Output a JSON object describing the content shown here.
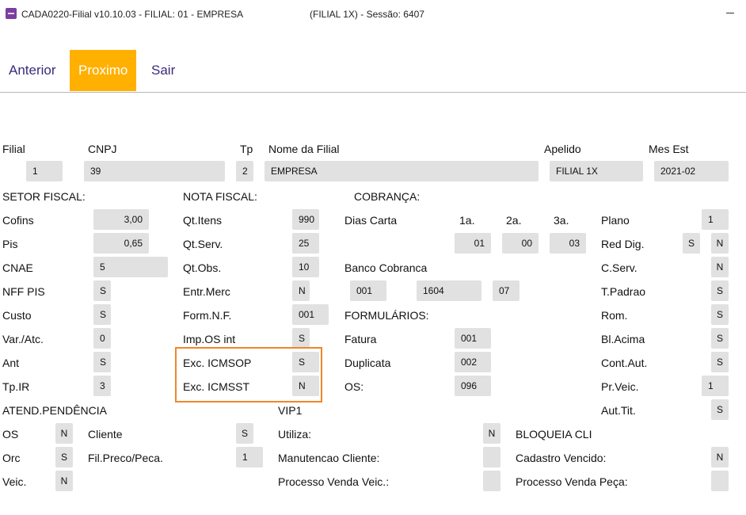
{
  "window": {
    "title": "CADA0220-Filial v10.10.03   - FILIAL: 01 - EMPRESA",
    "session": "(FILIAL 1X) - Sessão: 6407"
  },
  "toolbar": {
    "anterior": "Anterior",
    "proximo": "Proximo",
    "sair": "Sair"
  },
  "header": {
    "filial_label": "Filial",
    "filial_value": "1",
    "cnpj_label": "CNPJ",
    "cnpj_value": "39",
    "tp_label": "Tp",
    "tp_value": "2",
    "nome_label": "Nome da Filial",
    "nome_value": "EMPRESA",
    "apelido_label": "Apelido",
    "apelido_value": "FILIAL 1X",
    "mes_label": "Mes Est",
    "mes_value": "2021-02"
  },
  "setor_fiscal": {
    "title": "SETOR FISCAL:",
    "cofins_label": "Cofins",
    "cofins_value": "3,00",
    "pis_label": "Pis",
    "pis_value": "0,65",
    "cnae_label": "CNAE",
    "cnae_value": "5",
    "nffpis_label": "NFF PIS",
    "nffpis_value": "S",
    "custo_label": "Custo",
    "custo_value": "S",
    "varatc_label": "Var./Atc.",
    "varatc_value": "0",
    "ant_label": "Ant",
    "ant_value": "S",
    "tpir_label": "Tp.IR",
    "tpir_value": "3"
  },
  "nota_fiscal": {
    "title": "NOTA FISCAL:",
    "qtitens_label": "Qt.Itens",
    "qtitens_value": "990",
    "qtserv_label": "Qt.Serv.",
    "qtserv_value": "25",
    "qtobs_label": "Qt.Obs.",
    "qtobs_value": "10",
    "entrmerc_label": "Entr.Merc",
    "entrmerc_value": "N",
    "formnf_label": "Form.N.F.",
    "formnf_value": "001",
    "imposint_label": "Imp.OS int",
    "imposint_value": "S",
    "excicmsop_label": "Exc. ICMSOP",
    "excicmsop_value": "S",
    "excicmsst_label": "Exc. ICMSST",
    "excicmsst_value": "N"
  },
  "cobranca": {
    "title": "COBRANÇA:",
    "dias_label": "Dias Carta",
    "col1_label": "1a.",
    "col2_label": "2a.",
    "col3_label": "3a.",
    "dias1": "01",
    "dias2": "00",
    "dias3": "03",
    "banco_label": "Banco Cobranca",
    "banco1": "001",
    "banco2": "1604",
    "banco3": "07"
  },
  "formularios": {
    "title": "FORMULÁRIOS:",
    "fatura_label": "Fatura",
    "fatura_value": "001",
    "duplicata_label": "Duplicata",
    "duplicata_value": "002",
    "os_label": "OS:",
    "os_value": "096"
  },
  "right_panel": {
    "plano_label": "Plano",
    "plano_value": "1",
    "reddig_label": "Red Dig.",
    "reddig_value1": "S",
    "reddig_value2": "N",
    "cserv_label": "C.Serv.",
    "cserv_value": "N",
    "tpadrao_label": "T.Padrao",
    "tpadrao_value": "S",
    "rom_label": "Rom.",
    "rom_value": "S",
    "blacima_label": "Bl.Acima",
    "blacima_value": "S",
    "contaut_label": "Cont.Aut.",
    "contaut_value": "S",
    "prveic_label": "Pr.Veic.",
    "prveic_value": "1",
    "auttit_label": "Aut.Tit.",
    "auttit_value": "S"
  },
  "atend": {
    "title": "ATEND.PENDÊNCIA",
    "os_label": "OS",
    "os_value": "N",
    "orc_label": "Orc",
    "orc_value": "S",
    "veic_label": "Veic.",
    "veic_value": "N",
    "cliente_label": "Cliente",
    "cliente_value": "S",
    "filpreco_label": "Fil.Preco/Peca.",
    "filpreco_value": "1"
  },
  "vip1": {
    "title": "VIP1",
    "utiliza_label": "Utiliza:",
    "utiliza_value": "N",
    "manut_label": "Manutencao Cliente:",
    "manut_value": "",
    "procveic_label": "Processo Venda Veic.:",
    "procveic_value": ""
  },
  "bloqueia": {
    "title": "BLOQUEIA CLI",
    "cadvenc_label": "Cadastro Vencido:",
    "cadvenc_value": "N",
    "procpeca_label": "Processo Venda Peça:",
    "procpeca_value": ""
  },
  "colors": {
    "accent": "#ffb000",
    "highlight": "#f0862a",
    "field": "#e1e1e1",
    "link": "#3b2a7a"
  }
}
